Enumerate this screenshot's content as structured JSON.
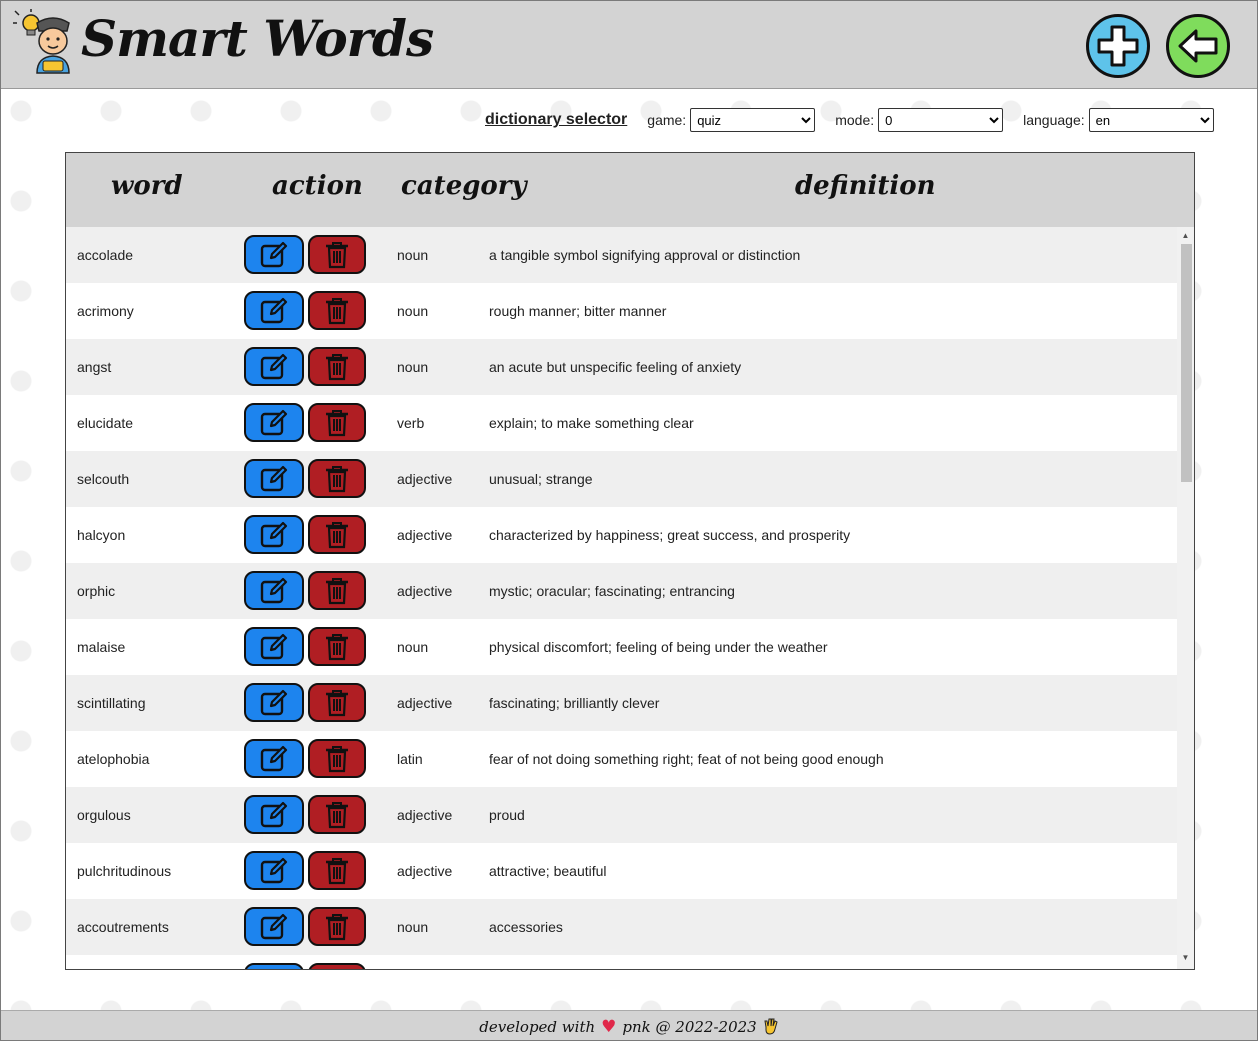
{
  "app": {
    "title": "Smart Words",
    "add_icon": "plus-icon",
    "back_icon": "arrow-left-icon"
  },
  "colors": {
    "header_bg": "#d3d3d3",
    "add_button": "#5ec3ea",
    "back_button": "#7fdc5c",
    "edit_button": "#1d84ee",
    "delete_button": "#b01e23",
    "row_alt": "#efefef"
  },
  "selector": {
    "title": "dictionary selector",
    "game_label": "game:",
    "game_value": "quiz",
    "mode_label": "mode:",
    "mode_value": "0",
    "language_label": "language:",
    "language_value": "en"
  },
  "table": {
    "headers": {
      "word": "word",
      "action": "action",
      "category": "category",
      "definition": "definition"
    },
    "rows": [
      {
        "word": "accolade",
        "category": "noun",
        "definition": "a tangible symbol signifying approval or distinction"
      },
      {
        "word": "acrimony",
        "category": "noun",
        "definition": "rough manner; bitter manner"
      },
      {
        "word": "angst",
        "category": "noun",
        "definition": "an acute but unspecific feeling of anxiety"
      },
      {
        "word": "elucidate",
        "category": "verb",
        "definition": "explain; to make something clear"
      },
      {
        "word": "selcouth",
        "category": "adjective",
        "definition": "unusual; strange"
      },
      {
        "word": "halcyon",
        "category": "adjective",
        "definition": "characterized by happiness; great success, and prosperity"
      },
      {
        "word": "orphic",
        "category": "adjective",
        "definition": "mystic; oracular; fascinating; entrancing"
      },
      {
        "word": "malaise",
        "category": "noun",
        "definition": "physical discomfort; feeling of being under the weather"
      },
      {
        "word": "scintillating",
        "category": "adjective",
        "definition": "fascinating; brilliantly clever"
      },
      {
        "word": "atelophobia",
        "category": "latin",
        "definition": "fear of not doing something right; feat of not being good enough"
      },
      {
        "word": "orgulous",
        "category": "adjective",
        "definition": "proud"
      },
      {
        "word": "pulchritudinous",
        "category": "adjective",
        "definition": "attractive; beautiful"
      },
      {
        "word": "accoutrements",
        "category": "noun",
        "definition": "accessories"
      },
      {
        "word": "",
        "category": "",
        "definition": ""
      }
    ]
  },
  "footer": {
    "prefix": "developed with",
    "heart_icon": "heart-icon",
    "suffix": "pnk @ 2022-2023",
    "hand_icon": "vulcan-salute-icon"
  }
}
